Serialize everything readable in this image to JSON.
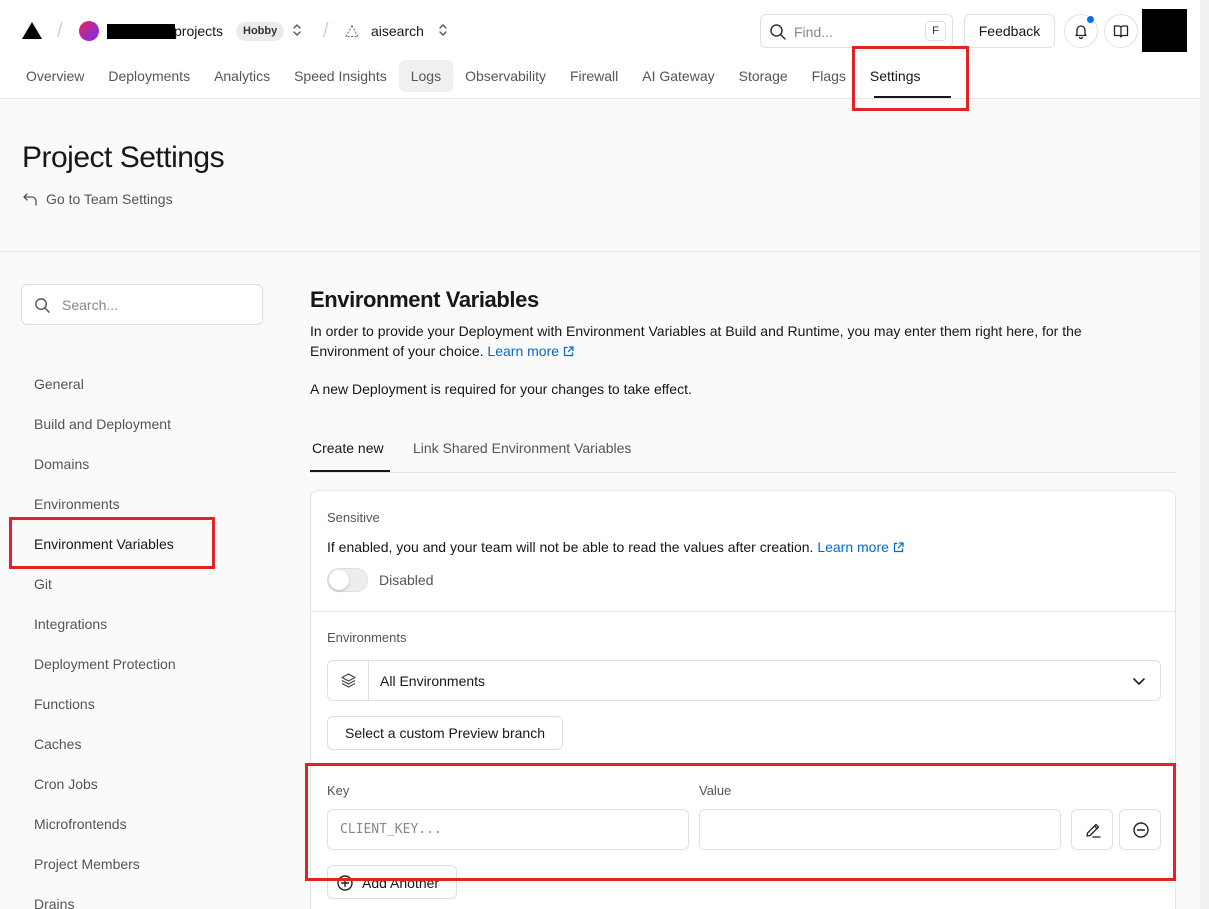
{
  "header": {
    "team_name": "projects",
    "plan_badge": "Hobby",
    "project_name": "aisearch",
    "find_placeholder": "Find...",
    "find_shortcut": "F",
    "feedback_label": "Feedback"
  },
  "nav": {
    "items": [
      "Overview",
      "Deployments",
      "Analytics",
      "Speed Insights",
      "Logs",
      "Observability",
      "Firewall",
      "AI Gateway",
      "Storage",
      "Flags",
      "Settings"
    ],
    "active": "Settings"
  },
  "page": {
    "title": "Project Settings",
    "team_settings_link": "Go to Team Settings"
  },
  "sidebar": {
    "search_placeholder": "Search...",
    "items": [
      "General",
      "Build and Deployment",
      "Domains",
      "Environments",
      "Environment Variables",
      "Git",
      "Integrations",
      "Deployment Protection",
      "Functions",
      "Caches",
      "Cron Jobs",
      "Microfrontends",
      "Project Members",
      "Drains"
    ],
    "active": "Environment Variables"
  },
  "main": {
    "title": "Environment Variables",
    "desc_1": "In order to provide your Deployment with Environment Variables at Build and Runtime, you may enter them right here, for the Environment of your choice.",
    "learn_more": "Learn more",
    "note": "A new Deployment is required for your changes to take effect.",
    "tabs": [
      "Create new",
      "Link Shared Environment Variables"
    ],
    "sensitive_label": "Sensitive",
    "sensitive_desc": "If enabled, you and your team will not be able to read the values after creation.",
    "toggle_label": "Disabled",
    "environments_label": "Environments",
    "environments_value": "All Environments",
    "branch_button": "Select a custom Preview branch",
    "key_label": "Key",
    "value_label": "Value",
    "key_placeholder": "CLIENT_KEY...",
    "add_another": "Add Another"
  },
  "colors": {
    "accent_link": "#0068d6",
    "highlight": "#e02424",
    "notification": "#0070f3"
  }
}
